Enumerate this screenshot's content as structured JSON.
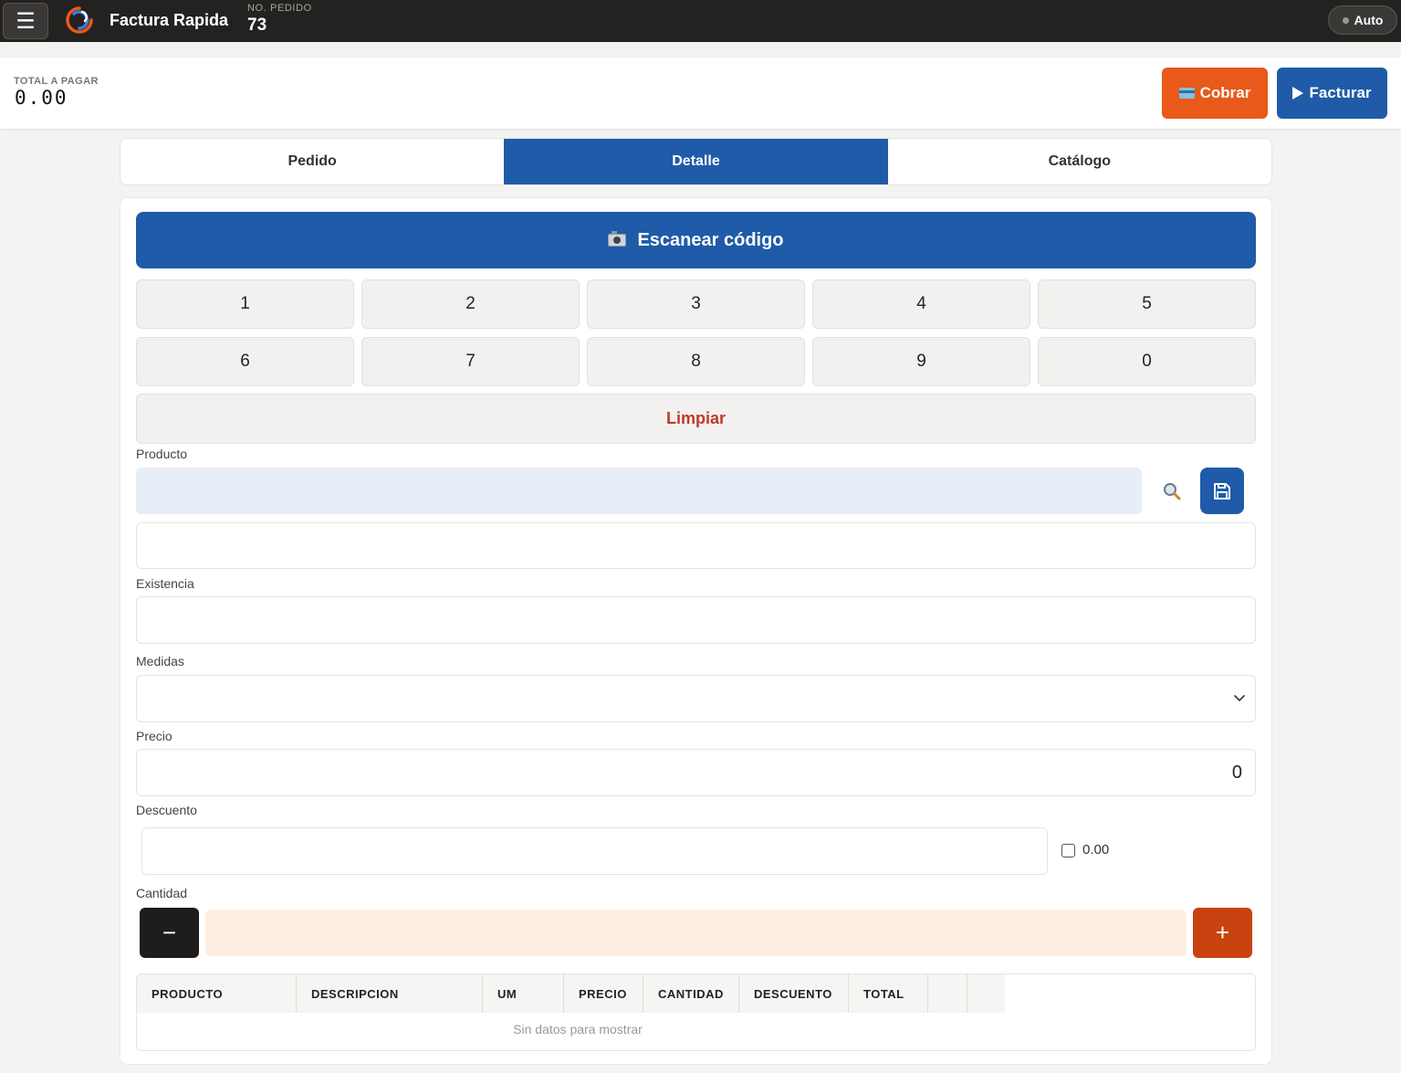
{
  "topbar": {
    "menu_icon": "hamburger-icon",
    "app_title": "Factura Rapida",
    "order_label": "NO. PEDIDO",
    "order_number": "73",
    "mode_label": "Auto"
  },
  "summary": {
    "total_label": "TOTAL A PAGAR",
    "total_value": "0.00",
    "cobrar_label": "Cobrar",
    "facturar_label": "Facturar"
  },
  "tabs": [
    {
      "label": "Pedido",
      "active": false
    },
    {
      "label": "Detalle",
      "active": true
    },
    {
      "label": "Catálogo",
      "active": false
    }
  ],
  "scanner": {
    "label": "Escanear código"
  },
  "keypad": {
    "keys": [
      "1",
      "2",
      "3",
      "4",
      "5",
      "6",
      "7",
      "8",
      "9",
      "0"
    ],
    "clear_label": "Limpiar"
  },
  "form": {
    "producto_label": "Producto",
    "producto_value": "",
    "descripcion_value": "",
    "existencia_label": "Existencia",
    "existencia_value": "",
    "medidas_label": "Medidas",
    "medidas_value": "",
    "precio_label": "Precio",
    "precio_value": "0",
    "descuento_label": "Descuento",
    "descuento_value": "",
    "descuento_pct": "0.00",
    "cantidad_label": "Cantidad",
    "cantidad_value": "",
    "minus_label": "−",
    "plus_label": "+"
  },
  "grid": {
    "columns": [
      "PRODUCTO",
      "DESCRIPCION",
      "UM",
      "PRECIO",
      "CANTIDAD",
      "DESCUENTO",
      "TOTAL",
      "",
      ""
    ],
    "empty_text": "Sin datos para mostrar"
  },
  "colors": {
    "primary": "#1f5ba8",
    "accent_orange": "#e8591a",
    "danger": "#c0392b",
    "topbar": "#242220"
  }
}
